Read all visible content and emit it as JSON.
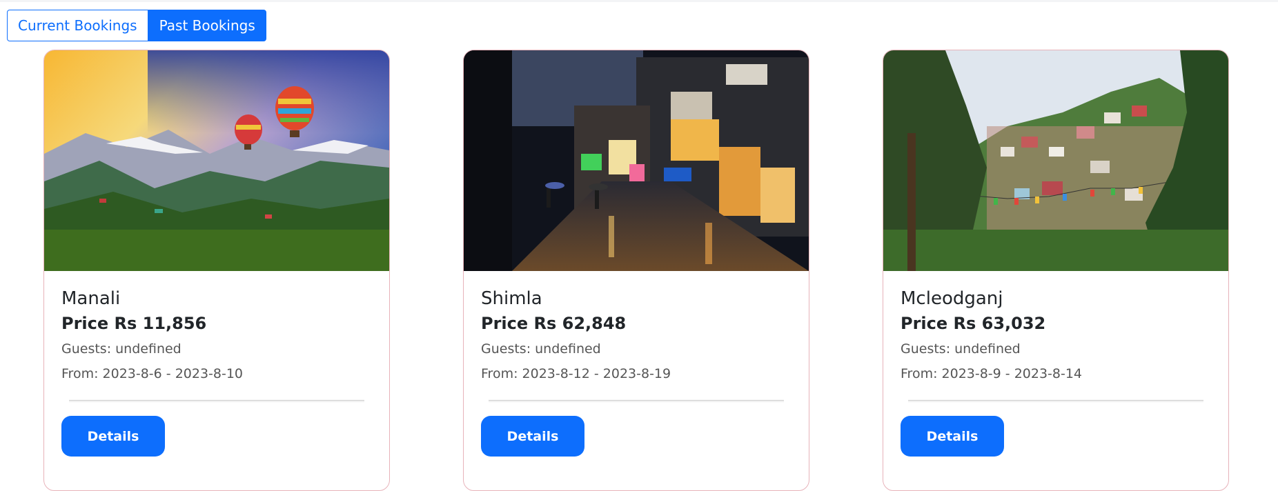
{
  "tabs": [
    {
      "label": "Current Bookings",
      "active": false
    },
    {
      "label": "Past Bookings",
      "active": true
    }
  ],
  "bookings": [
    {
      "name": "Manali",
      "price": "Price Rs 11,856",
      "guests": "Guests: undefined",
      "dates": "From: 2023-8-6 - 2023-8-10",
      "button": "Details"
    },
    {
      "name": "Shimla",
      "price": "Price Rs 62,848",
      "guests": "Guests: undefined",
      "dates": "From: 2023-8-12 - 2023-8-19",
      "button": "Details"
    },
    {
      "name": "Mcleodganj",
      "price": "Price Rs 63,032",
      "guests": "Guests: undefined",
      "dates": "From: 2023-8-9 - 2023-8-14",
      "button": "Details"
    }
  ],
  "colors": {
    "primary": "#0d6efd",
    "card_border": "#e7b2b9"
  }
}
